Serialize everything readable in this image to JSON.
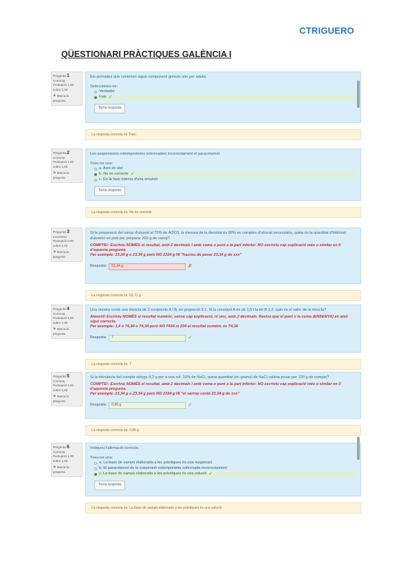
{
  "header": {
    "brand": "CTRIGUERO",
    "title": "QÜESTIONARI PRÀCTIQUES GALÈNCIA I"
  },
  "questions": [
    {
      "number": "1",
      "question_label": "Pregunta",
      "status": "Correcta",
      "score_line1": "Puntuació 1,00",
      "score_line2": "sobre 1,00",
      "flag": "Marca la pregunta",
      "text": "Els pomades que contenen algun component greixós són per adults.",
      "select_label": "Seleccioneu-ne:",
      "options": [
        "Verdader",
        "Fals"
      ],
      "selected": 1,
      "correct_option": 1,
      "check_button": "Torna resposta",
      "feedback": "La resposta correcta és 'Fals'."
    },
    {
      "number": "2",
      "question_label": "Pregunta",
      "status": "Correcta",
      "score_line1": "Puntuació 1,00",
      "score_line2": "sobre 1,00",
      "flag": "Marca la pregunta",
      "text": "Les suspensions extemporànies sobrenaden incorrectament el paracetamol.",
      "select_label": "Trieu-ne una:",
      "options": [
        "a. Això és així",
        "b. No és correcte",
        "c. En la fase interna d'una emulsió"
      ],
      "selected": 1,
      "correct_option": 1,
      "check_button": "Torna resposta",
      "feedback": "La resposta correcta és: No és correcte"
    },
    {
      "number": "3",
      "question_label": "Pregunta",
      "status": "Incorrecta",
      "score_line1": "Puntuació 0,00",
      "score_line2": "sobre 1,00",
      "flag": "Marca la pregunta",
      "text": "Si la preparació del xarop d'ulcerat al 70% de Al2O3, la mesura de la densitat és 99% en comptes d'ulcerat necessària, quina és la quantitat d'hidròxid d'alumini en pols per preparar 200 g de xarop?",
      "red_line1": "COMPTE!: Escriviu NOMÉS el resultat, amb 2 decimals i amb coma o punt a la part inferior. NO escriviu cap explicació més o similar en 0 d'aquesta pregunta.",
      "red_line2": "Per exemple: 23,34 g o 23.34 g però NO 2334 g NI \"haureu de pesar 23,34 g de xxx\"",
      "answer_label": "Resposta:",
      "answer_value": "51,14 g",
      "answer_ok": false,
      "feedback": "La resposta correcta és: 52,71 g"
    },
    {
      "number": "4",
      "question_label": "Pregunta",
      "status": "Correcta",
      "score_line1": "Puntuació 1,00",
      "score_line2": "sobre 1,00",
      "flag": "Marca la pregunta",
      "text": "Una mostra conté una mescla de 2 excipients A i B, en proporció 2:1. Si la constant A és de 1,5 i la de B 1,2, quin és el valor de la mescla?",
      "red_line1": "Atenció! Escriviu NOMÉS el resultat numèric, sense cap explicació, ni uns, amb 2 decimals. Revisa que el punt o la coma (ENSENYA) en això sigui correcte.",
      "red_line2": "Per exemple: 1,4 o 74,34 o 74,34 però NO 7434 ni 234 el resultat numèric és 74,34",
      "answer_label": "Resposta:",
      "answer_value": "7",
      "answer_ok": true,
      "feedback": "La resposta correcta és: 7"
    },
    {
      "number": "5",
      "question_label": "Pregunta",
      "status": "Correcta",
      "score_line1": "Puntuació 1,00",
      "score_line2": "sobre 1,00",
      "flag": "Marca la pregunta",
      "text": "Si la tolerància del compte xiringa 4,2 g per a una sol. 10% de NaCl, quina quantitat (en grams) de NaCl caldria pesar per 100 g de compte?",
      "red_line1": "COMPTE!: Escriviu NOMÉS el resultat, amb 2 decimals i amb coma o punt a la part inferior. NO escriviu cap explicació més o similar en 0 d'aquesta pregunta.",
      "red_line2": "Per exemple: 23,34 g o 23.34 g però NO 2334 g NI \"el xarrop conté 23,34 g de xxx\"",
      "answer_label": "Resposta:",
      "answer_value": "0,86 g",
      "answer_ok": true,
      "feedback": "La resposta correcta és: 0,86 g"
    },
    {
      "number": "6",
      "question_label": "Pregunta",
      "status": "Correcta",
      "score_line1": "Puntuació 1,00",
      "score_line2": "sobre 1,00",
      "flag": "Marca la pregunta",
      "text": "Indiqueu l'afirmació correcta.",
      "select_label": "Trieu-ne una:",
      "options": [
        "a. La base de xampú elaborada a les pràctiques és una suspensió",
        "b. El paracetamol de la suspensió extemporània sobrenada incorrectament",
        "c. La base de xampú elaborada a les pràctiques és una solució"
      ],
      "selected": 2,
      "correct_option": 2,
      "check_button": "Torna resposta",
      "feedback": "La resposta correcta és: La base de xampú elaborada a les pràctiques és una solució"
    }
  ]
}
